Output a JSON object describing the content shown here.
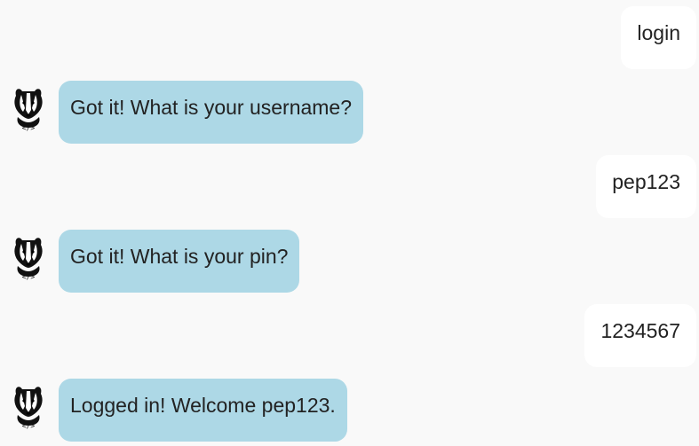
{
  "messages": [
    {
      "role": "user",
      "text": "login"
    },
    {
      "role": "bot",
      "text": "Got it! What is your username?"
    },
    {
      "role": "user",
      "text": "pep123"
    },
    {
      "role": "bot",
      "text": "Got it! What is your pin?"
    },
    {
      "role": "user",
      "text": "1234567"
    },
    {
      "role": "bot",
      "text": "Logged in! Welcome pep123."
    }
  ],
  "bot_avatar": {
    "icon": "badger-icon"
  },
  "colors": {
    "background": "#f9f9f9",
    "user_bubble": "#ffffff",
    "bot_bubble": "#add8e6",
    "text": "#222222"
  }
}
